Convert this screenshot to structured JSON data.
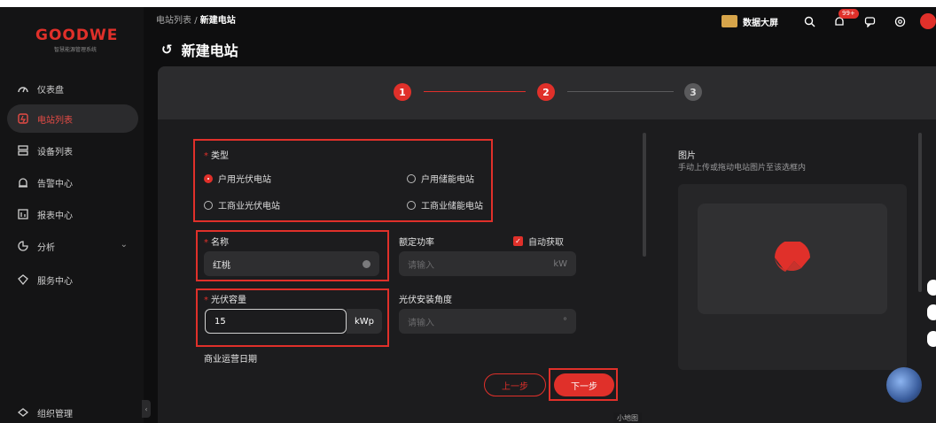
{
  "app": {
    "brand": "GOODWE",
    "brand_sub": "智慧能源管理系统"
  },
  "sidebar": {
    "items": [
      {
        "label": "仪表盘",
        "icon": "dashboard-icon"
      },
      {
        "label": "电站列表",
        "icon": "plant-icon",
        "active": true
      },
      {
        "label": "设备列表",
        "icon": "device-icon"
      },
      {
        "label": "告警中心",
        "icon": "alarm-icon"
      },
      {
        "label": "报表中心",
        "icon": "report-icon"
      },
      {
        "label": "分析",
        "icon": "analysis-icon",
        "expandable": true
      },
      {
        "label": "服务中心",
        "icon": "service-icon"
      }
    ],
    "bottom_item": {
      "label": "组织管理",
      "icon": "org-icon"
    }
  },
  "header": {
    "breadcrumb_parent": "电站列表",
    "breadcrumb_sep": "/",
    "breadcrumb_current": "新建电站",
    "title": "新建电站",
    "big_screen_label": "数据大屏",
    "notification_badge": "99+"
  },
  "steps": {
    "items": [
      "1",
      "2",
      "3"
    ],
    "current": 2
  },
  "form": {
    "type_label": "类型",
    "type_options": [
      "户用光伏电站",
      "户用储能电站",
      "工商业光伏电站",
      "工商业储能电站"
    ],
    "type_selected": "户用光伏电站",
    "name_label": "名称",
    "name_value": "红桃",
    "rated_power_label": "额定功率",
    "rated_power_placeholder": "请输入",
    "rated_power_unit": "kW",
    "auto_fetch_label": "自动获取",
    "pv_capacity_label": "光伏容量",
    "pv_capacity_value": "15",
    "pv_capacity_unit": "kWp",
    "pv_angle_label": "光伏安装角度",
    "pv_angle_placeholder": "请输入",
    "pv_angle_unit": "°",
    "commercial_date_label": "商业运营日期",
    "prev_button": "上一步",
    "next_button": "下一步"
  },
  "image_panel": {
    "title": "图片",
    "hint": "手动上传或拖动电站图片至该选框内"
  },
  "minimap_label": "小地图",
  "colors": {
    "accent": "#e0302a",
    "bg": "#0e0e0f",
    "panel": "#1c1c1e"
  }
}
